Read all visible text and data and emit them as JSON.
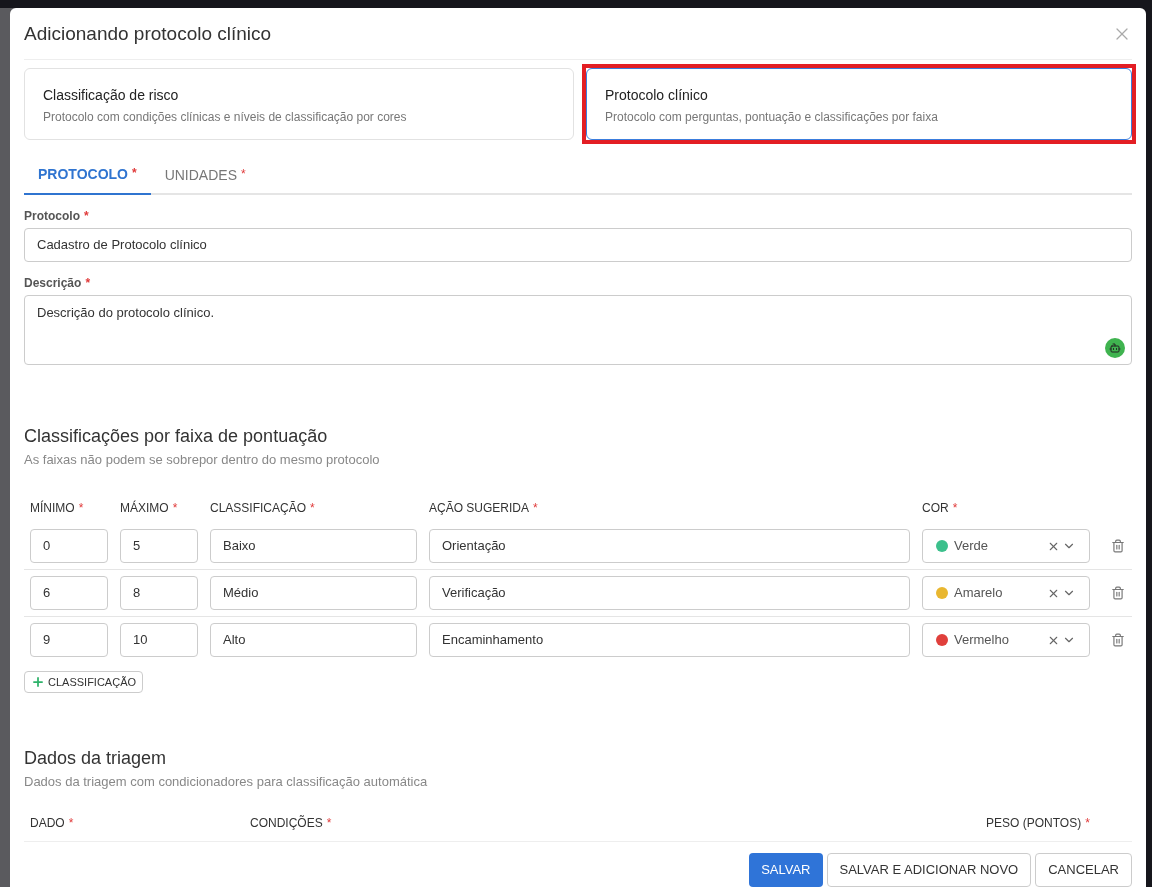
{
  "dialog": {
    "title": "Adicionando protocolo clínico"
  },
  "required_mark": "*",
  "protocol_types": [
    {
      "title": "Classificação de risco",
      "description": "Protocolo com condições clínicas e níveis de classificação por cores",
      "selected": false,
      "highlighted": false
    },
    {
      "title": "Protocolo clínico",
      "description": "Protocolo com perguntas, pontuação e classificações por faixa",
      "selected": true,
      "highlighted": true
    }
  ],
  "tabs": [
    {
      "label": "PROTOCOLO",
      "required": true,
      "selected": true
    },
    {
      "label": "UNIDADES",
      "required": true,
      "selected": false
    }
  ],
  "fields": [
    {
      "kind": "text",
      "label": "Protocolo",
      "required": true,
      "value": "Cadastro de Protocolo clínico"
    },
    {
      "kind": "textarea",
      "label": "Descrição",
      "required": true,
      "value": "Descrição do protocolo clínico."
    }
  ],
  "ranges_section": {
    "title": "Classificações por faixa de pontuação",
    "subtitle": "As faixas não podem se sobrepor dentro do mesmo protocolo",
    "columns": [
      {
        "label": "MÍNIMO",
        "required": true
      },
      {
        "label": "MÁXIMO",
        "required": true
      },
      {
        "label": "CLASSIFICAÇÃO",
        "required": true
      },
      {
        "label": "AÇÃO SUGERIDA",
        "required": true
      },
      {
        "label": "COR",
        "required": true
      }
    ],
    "rows": [
      {
        "minimum": "0",
        "maximum": "5",
        "classification": "Baixo",
        "action": "Orientação",
        "color_name": "Verde",
        "color": "#3cc08c"
      },
      {
        "minimum": "6",
        "maximum": "8",
        "classification": "Médio",
        "action": "Verificação",
        "color_name": "Amarelo",
        "color": "#e9b730"
      },
      {
        "minimum": "9",
        "maximum": "10",
        "classification": "Alto",
        "action": "Encaminhamento",
        "color_name": "Vermelho",
        "color": "#e0403c"
      }
    ],
    "add_button": "CLASSIFICAÇÃO"
  },
  "triage_section": {
    "title": "Dados da triagem",
    "subtitle": "Dados da triagem com condicionadores para classificação automática",
    "columns": [
      {
        "label": "DADO",
        "required": true
      },
      {
        "label": "CONDIÇÕES",
        "required": true
      },
      {
        "label": "PESO (PONTOS)",
        "required": true
      }
    ]
  },
  "buttons": [
    {
      "label": "SALVAR",
      "kind": "primary"
    },
    {
      "label": "SALVAR E ADICIONAR NOVO",
      "kind": "default"
    },
    {
      "label": "CANCELAR",
      "kind": "default"
    }
  ]
}
